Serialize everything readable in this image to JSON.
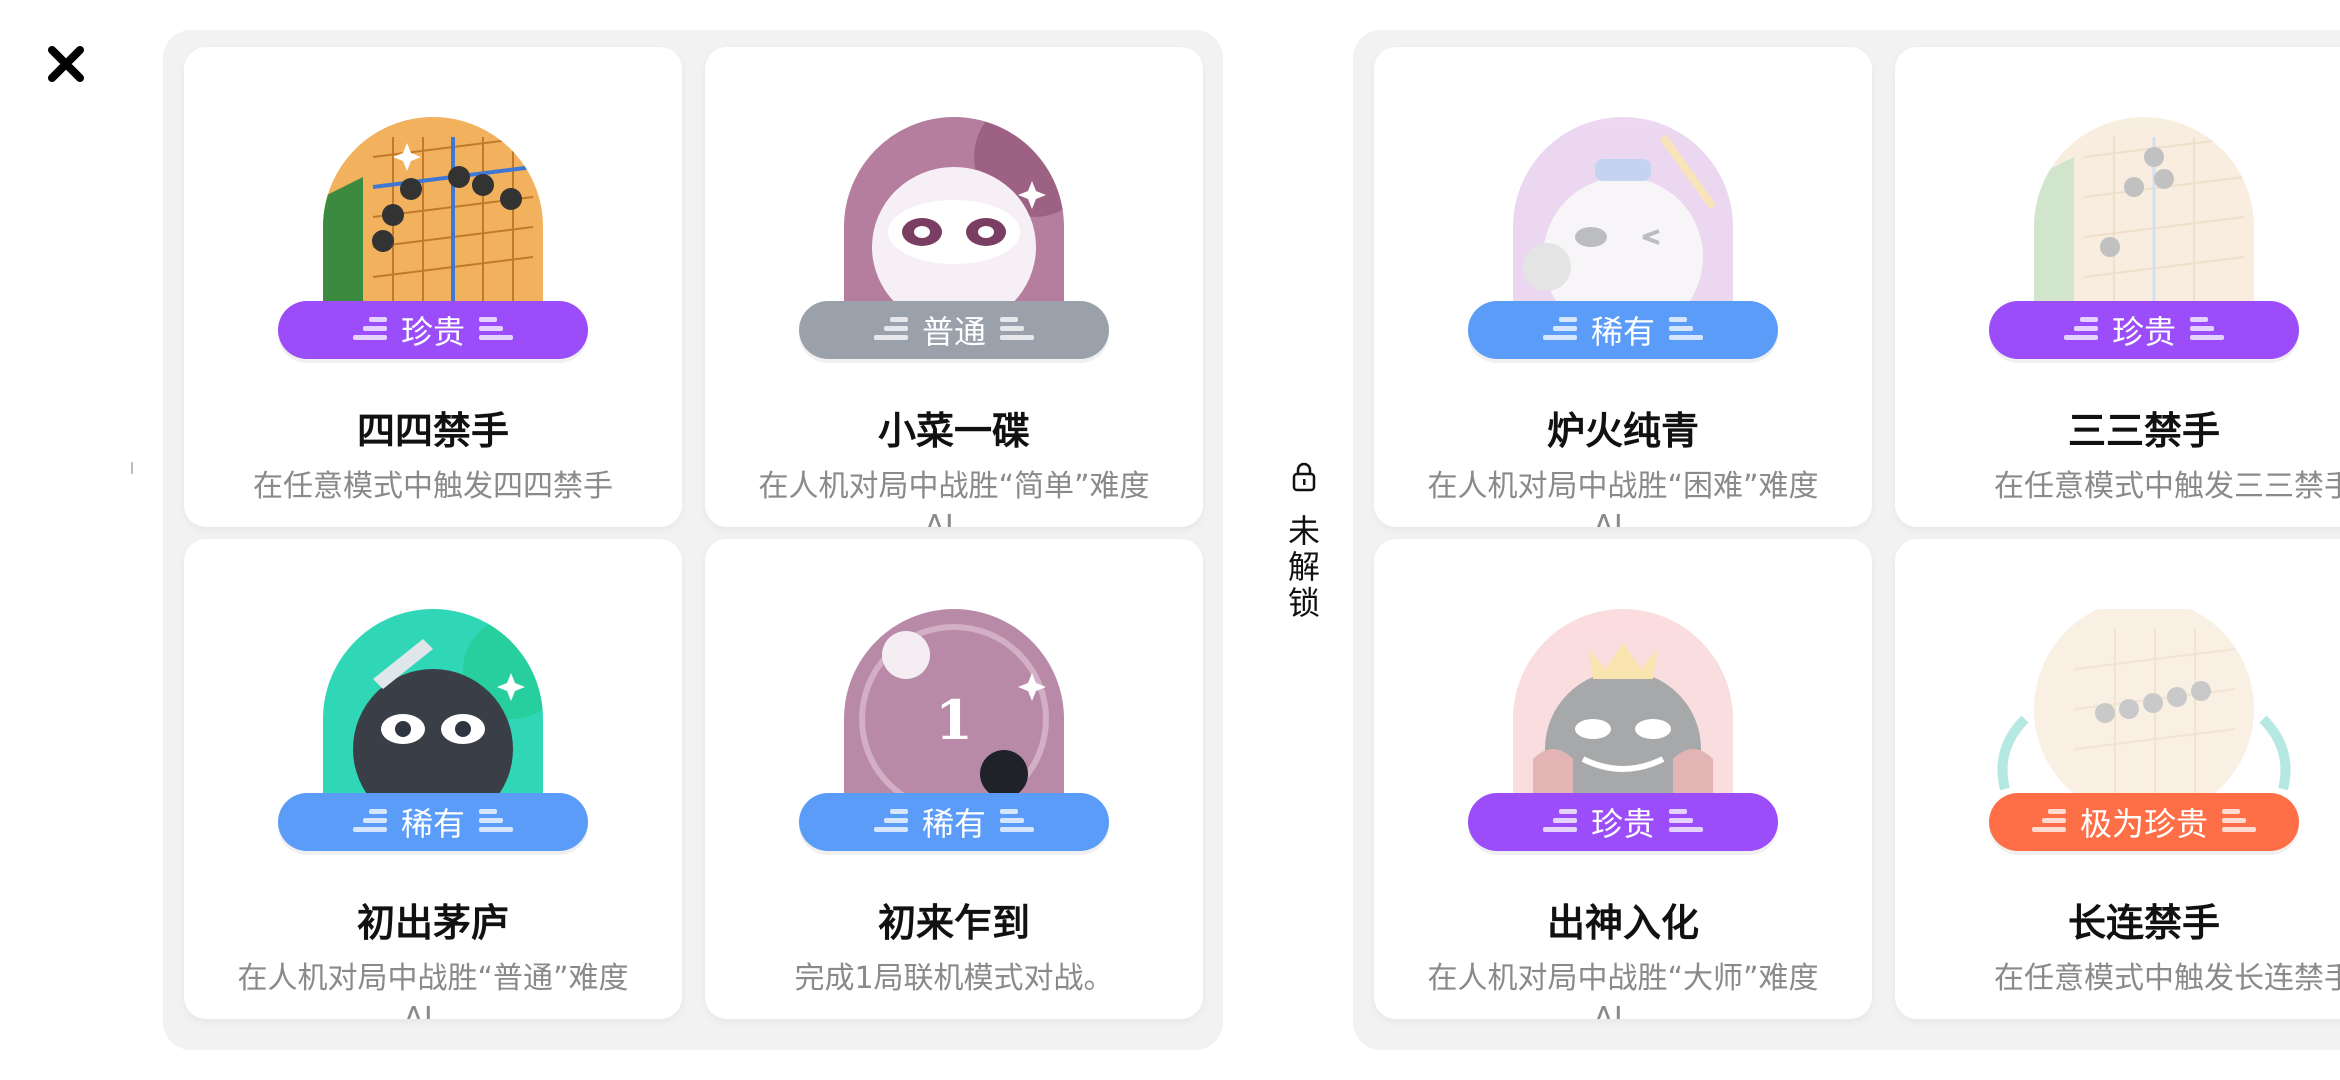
{
  "close_icon": "close-icon",
  "locked_section_label": "未解锁",
  "colors": {
    "precious": "#9b4dfa",
    "common": "#9aa1ab",
    "rare": "#5b9cf9",
    "ultra_precious": "#ff6f47"
  },
  "unlocked": [
    {
      "title": "四四禁手",
      "rarity": "珍贵",
      "desc": "在任意模式中触发四四禁手"
    },
    {
      "title": "小菜一碟",
      "rarity": "普通",
      "desc": "在人机对局中战胜“简单”难度AI。"
    },
    {
      "title": "初出茅庐",
      "rarity": "稀有",
      "desc": "在人机对局中战胜“普通”难度AI。"
    },
    {
      "title": "初来乍到",
      "rarity": "稀有",
      "desc": "完成1局联机模式对战。",
      "badge_number": "1"
    }
  ],
  "locked": [
    {
      "title": "炉火纯青",
      "rarity": "稀有",
      "desc": "在人机对局中战胜“困难”难度AI。"
    },
    {
      "title": "三三禁手",
      "rarity": "珍贵",
      "desc": "在任意模式中触发三三禁手"
    },
    {
      "title": "出神入化",
      "rarity": "珍贵",
      "desc": "在人机对局中战胜“大师”难度AI。"
    },
    {
      "title": "长连禁手",
      "rarity": "极为珍贵",
      "desc": "在任意模式中触发长连禁手"
    }
  ]
}
